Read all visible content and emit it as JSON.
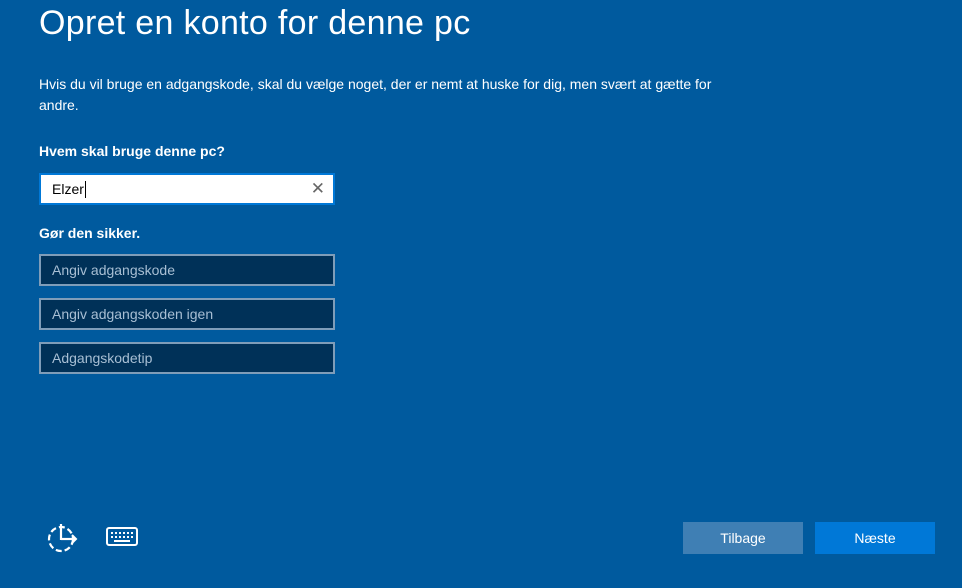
{
  "title": "Opret en konto for denne pc",
  "description": "Hvis du vil bruge en adgangskode, skal du vælge noget, der er nemt at huske for dig, men svært at gætte for andre.",
  "user_label": "Hvem skal bruge denne pc?",
  "user_value": "Elzer",
  "secure_label": "Gør den sikker.",
  "password_placeholder": "Angiv adgangskode",
  "password_confirm_placeholder": "Angiv adgangskoden igen",
  "hint_placeholder": "Adgangskodetip",
  "clear_glyph": "✕",
  "back_label": "Tilbage",
  "next_label": "Næste"
}
